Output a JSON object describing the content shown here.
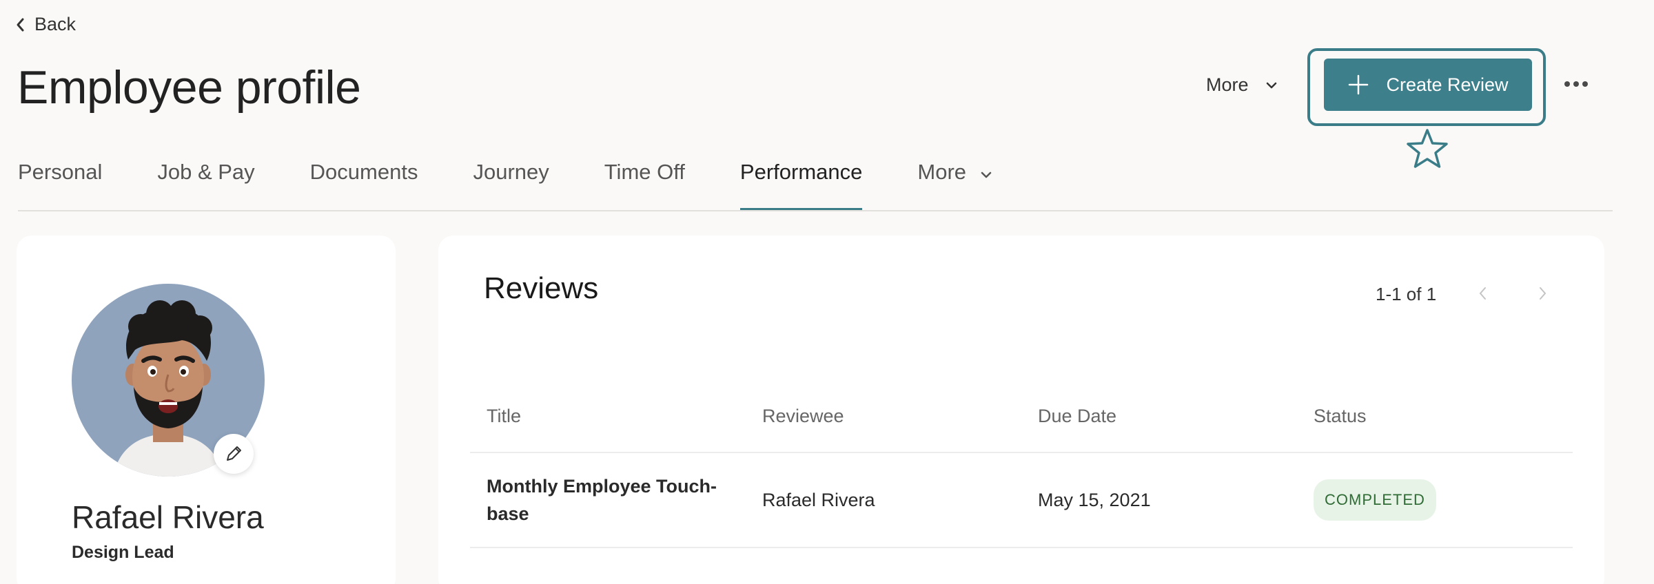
{
  "nav": {
    "back_label": "Back"
  },
  "page": {
    "title": "Employee profile"
  },
  "header": {
    "more_label": "More",
    "create_label": "Create Review"
  },
  "tabs": [
    {
      "label": "Personal"
    },
    {
      "label": "Job & Pay"
    },
    {
      "label": "Documents"
    },
    {
      "label": "Journey"
    },
    {
      "label": "Time Off"
    },
    {
      "label": "Performance",
      "active": true
    },
    {
      "label": "More"
    }
  ],
  "profile": {
    "name": "Rafael Rivera",
    "role": "Design Lead"
  },
  "reviews": {
    "title": "Reviews",
    "pagination": "1-1 of 1",
    "columns": [
      "Title",
      "Reviewee",
      "Due Date",
      "Status"
    ],
    "rows": [
      {
        "title": "Monthly Employee Touch-base",
        "reviewee": "Rafael Rivera",
        "due_date": "May 15, 2021",
        "status": "COMPLETED"
      }
    ]
  },
  "icons": {
    "back": "chevron-left-icon",
    "more": "chevron-down-icon",
    "create": "plus-icon",
    "options": "more-horizontal-icon",
    "edit": "pencil-icon",
    "highlight": "star-icon",
    "prev": "chevron-left-icon",
    "next": "chevron-right-icon"
  },
  "colors": {
    "accent": "#3d7f8a",
    "background": "#faf9f7",
    "status_bg": "#e8f3e8",
    "status_text": "#2f6b35",
    "avatar_bg": "#8fa3bd"
  }
}
